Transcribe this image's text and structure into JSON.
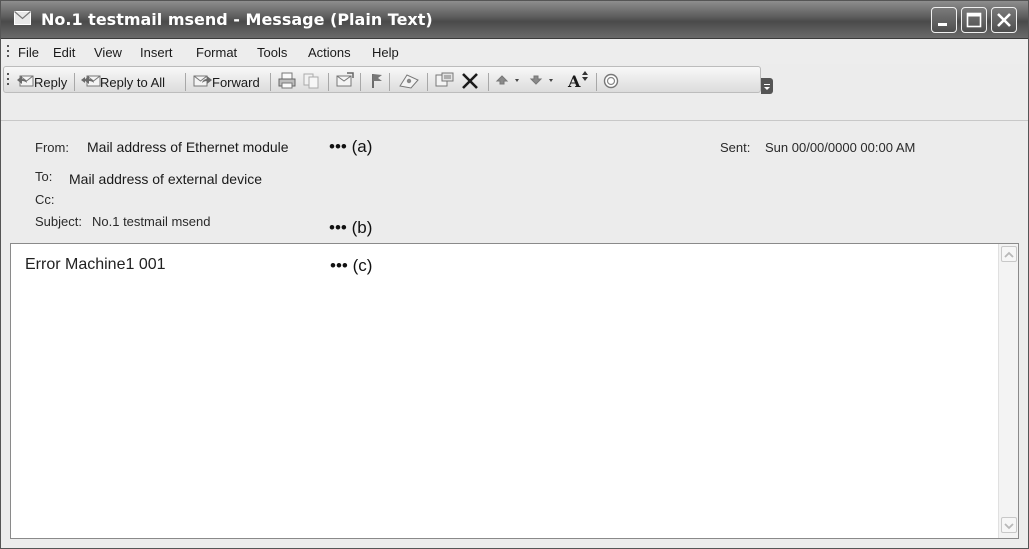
{
  "window": {
    "title": "No.1 testmail msend - Message (Plain Text)"
  },
  "menu": {
    "items": [
      {
        "label": "File"
      },
      {
        "label": "Edit"
      },
      {
        "label": "View"
      },
      {
        "label": "Insert"
      },
      {
        "label": "Format"
      },
      {
        "label": "Tools"
      },
      {
        "label": "Actions"
      },
      {
        "label": "Help"
      }
    ]
  },
  "toolbar": {
    "reply": "Reply",
    "reply_all": "Reply to All",
    "forward": "Forward",
    "font_size_glyph": "A"
  },
  "header": {
    "from_label": "From:",
    "from_value": "Mail address of Ethernet module",
    "annot_a": "••• (a)",
    "sent_label": "Sent:",
    "sent_value": "Sun 00/00/0000 00:00 AM",
    "to_label": "To:",
    "to_value": "Mail address of external device",
    "cc_label": "Cc:",
    "subject_label": "Subject:",
    "subject_value": "No.1 testmail msend",
    "annot_b": "••• (b)"
  },
  "body": {
    "text": "Error Machine1 001",
    "annot_c": "••• (c)"
  }
}
